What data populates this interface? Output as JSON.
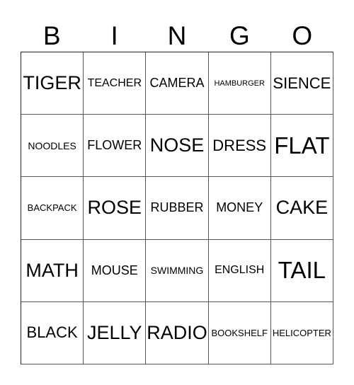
{
  "header": {
    "letters": [
      "B",
      "I",
      "N",
      "G",
      "O"
    ]
  },
  "card": {
    "rows": [
      [
        "TIGER",
        "TEACHER",
        "CAMERA",
        "HAMBURGER",
        "SIENCE"
      ],
      [
        "NOODLES",
        "FLOWER",
        "NOSE",
        "DRESS",
        "FLAT"
      ],
      [
        "BACKPACK",
        "ROSE",
        "RUBBER",
        "MONEY",
        "CAKE"
      ],
      [
        "MATH",
        "MOUSE",
        "SWIMMING",
        "ENGLISH",
        "TAIL"
      ],
      [
        "BLACK",
        "JELLY",
        "RADIO",
        "BOOKSHELF",
        "HELICOPTER"
      ]
    ]
  }
}
